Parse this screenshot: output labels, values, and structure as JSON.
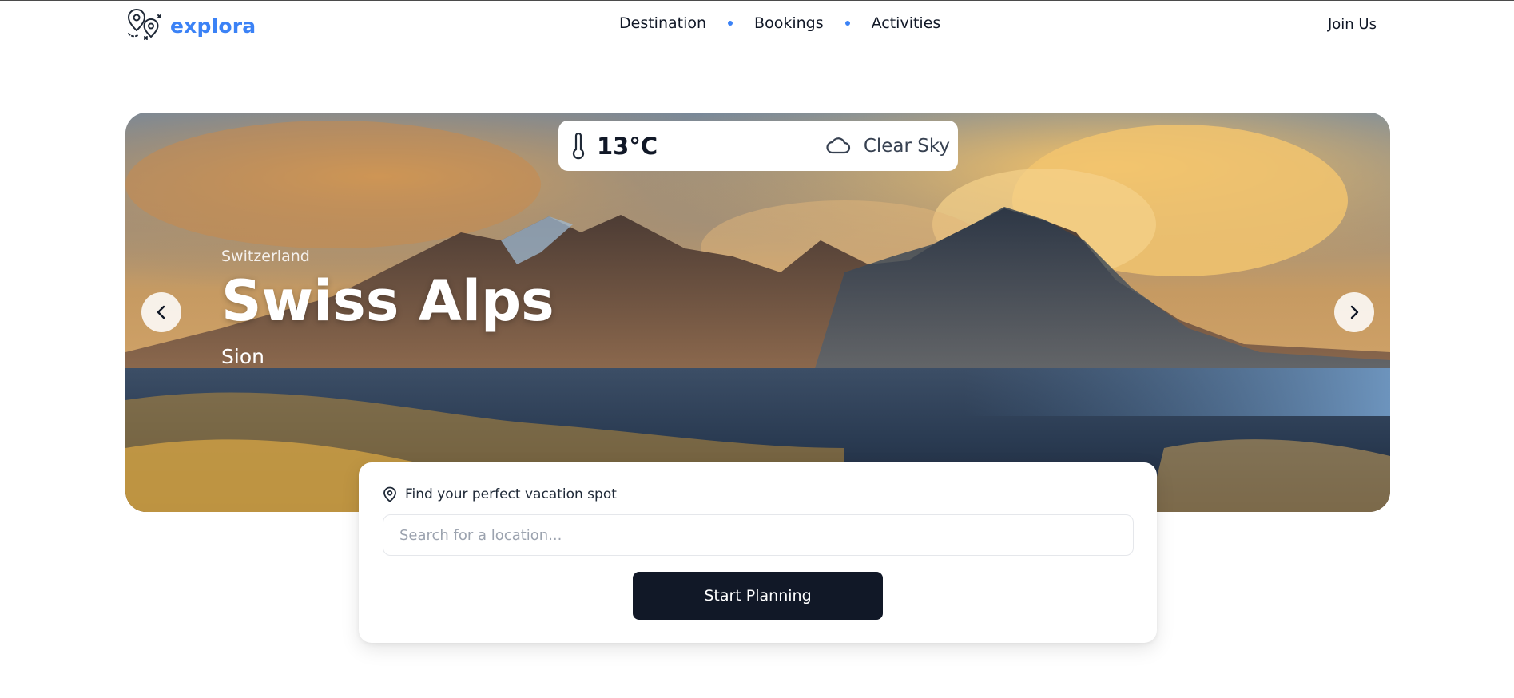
{
  "brand": {
    "name": "explora",
    "accent_color": "#3b82f6",
    "logo_icon": "map-pin-route-icon"
  },
  "nav": {
    "items": [
      {
        "label": "Destination"
      },
      {
        "label": "Bookings"
      },
      {
        "label": "Activities"
      }
    ],
    "join_label": "Join Us"
  },
  "hero": {
    "weather": {
      "temperature": "13°C",
      "temp_icon": "thermometer-icon",
      "condition": "Clear Sky",
      "condition_icon": "cloud-icon"
    },
    "country": "Switzerland",
    "title": "Swiss Alps",
    "city": "Sion",
    "prev_icon": "chevron-left-icon",
    "next_icon": "chevron-right-icon"
  },
  "search": {
    "label": "Find your perfect vacation spot",
    "label_icon": "map-pin-icon",
    "placeholder": "Search for a location...",
    "value": "",
    "button_label": "Start Planning",
    "button_color": "#111827"
  }
}
